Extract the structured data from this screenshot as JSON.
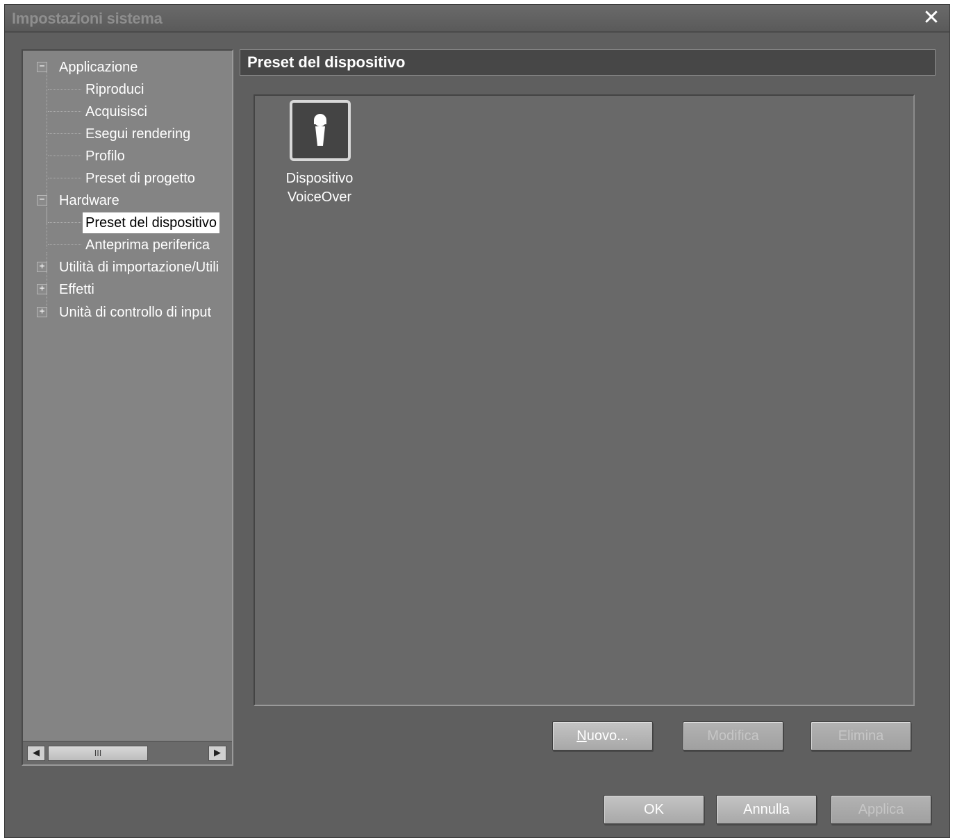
{
  "window": {
    "title": "Impostazioni sistema",
    "close_glyph": "✕"
  },
  "tree": {
    "nodes": [
      {
        "label": "Applicazione",
        "expander": "−"
      },
      {
        "label": "Riproduci"
      },
      {
        "label": "Acquisisci"
      },
      {
        "label": "Esegui rendering"
      },
      {
        "label": "Profilo"
      },
      {
        "label": "Preset di progetto"
      },
      {
        "label": "Hardware",
        "expander": "−"
      },
      {
        "label": "Preset del dispositivo",
        "selected": true
      },
      {
        "label": "Anteprima periferica"
      },
      {
        "label": "Utilità di importazione/Utili",
        "expander": "+"
      },
      {
        "label": "Effetti",
        "expander": "+"
      },
      {
        "label": "Unità di controllo di input",
        "expander": "+"
      }
    ],
    "scrollbar": {
      "left_arrow": "◀",
      "right_arrow": "▶",
      "thumb_grip": "III"
    }
  },
  "section": {
    "title": "Preset del dispositivo"
  },
  "presets": [
    {
      "icon": "microphone-icon",
      "label_line1": "Dispositivo",
      "label_line2": "VoiceOver"
    }
  ],
  "preset_buttons": {
    "new_mnemonic": "N",
    "new_rest": "uovo...",
    "modify_label": "Modifica",
    "delete_label": "Elimina"
  },
  "dialog_buttons": {
    "ok_label": "OK",
    "cancel_label": "Annulla",
    "apply_label": "Applica"
  },
  "colors": {
    "window_bg": "#5f5f5f",
    "tree_bg": "#848484",
    "panel_bg": "#696969",
    "selection_bg": "#ffffff"
  }
}
